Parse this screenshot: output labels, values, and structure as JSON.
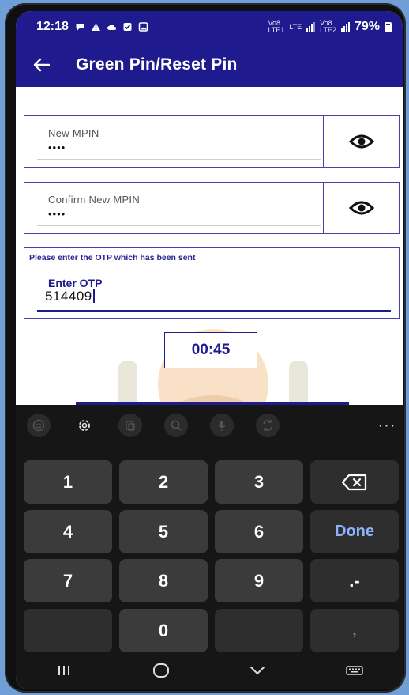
{
  "status_bar": {
    "time": "12:18",
    "network_labels": [
      "Vo8",
      "LTE1",
      "LTE",
      "LTE2"
    ],
    "battery_pct": "79%"
  },
  "app_bar": {
    "title": "Green Pin/Reset Pin",
    "back_icon": "arrow-left-icon"
  },
  "form": {
    "new_mpin": {
      "label": "New MPIN",
      "value": "••••",
      "toggle_icon": "eye-icon"
    },
    "confirm_mpin": {
      "label": "Confirm New MPIN",
      "value": "••••",
      "toggle_icon": "eye-icon"
    },
    "otp": {
      "hint": "Please enter the OTP which has been sent",
      "label": "Enter OTP",
      "value": "514409"
    },
    "timer": "00:45"
  },
  "keyboard": {
    "toolbar_icons": [
      "emoji-icon",
      "settings-icon",
      "clipboard-icon",
      "search-icon",
      "mic-icon",
      "translate-icon",
      "more-icon"
    ],
    "more_label": "···",
    "keys": {
      "k1": "1",
      "k2": "2",
      "k3": "3",
      "k4": "4",
      "k5": "5",
      "k6": "6",
      "k7": "7",
      "k8": "8",
      "k9": "9",
      "k0": "0",
      "done": "Done",
      "dot_dash": ".-",
      "comma": ","
    }
  },
  "nav_bar": {
    "icons": [
      "recents-icon",
      "home-icon",
      "back-chevron-icon",
      "keyboard-switch-icon"
    ]
  },
  "colors": {
    "primary": "#1f1b8f",
    "background": "#6f9fd6",
    "keyboard": "#161616",
    "key": "#3b3b3b",
    "done_text": "#8fb4ff"
  }
}
